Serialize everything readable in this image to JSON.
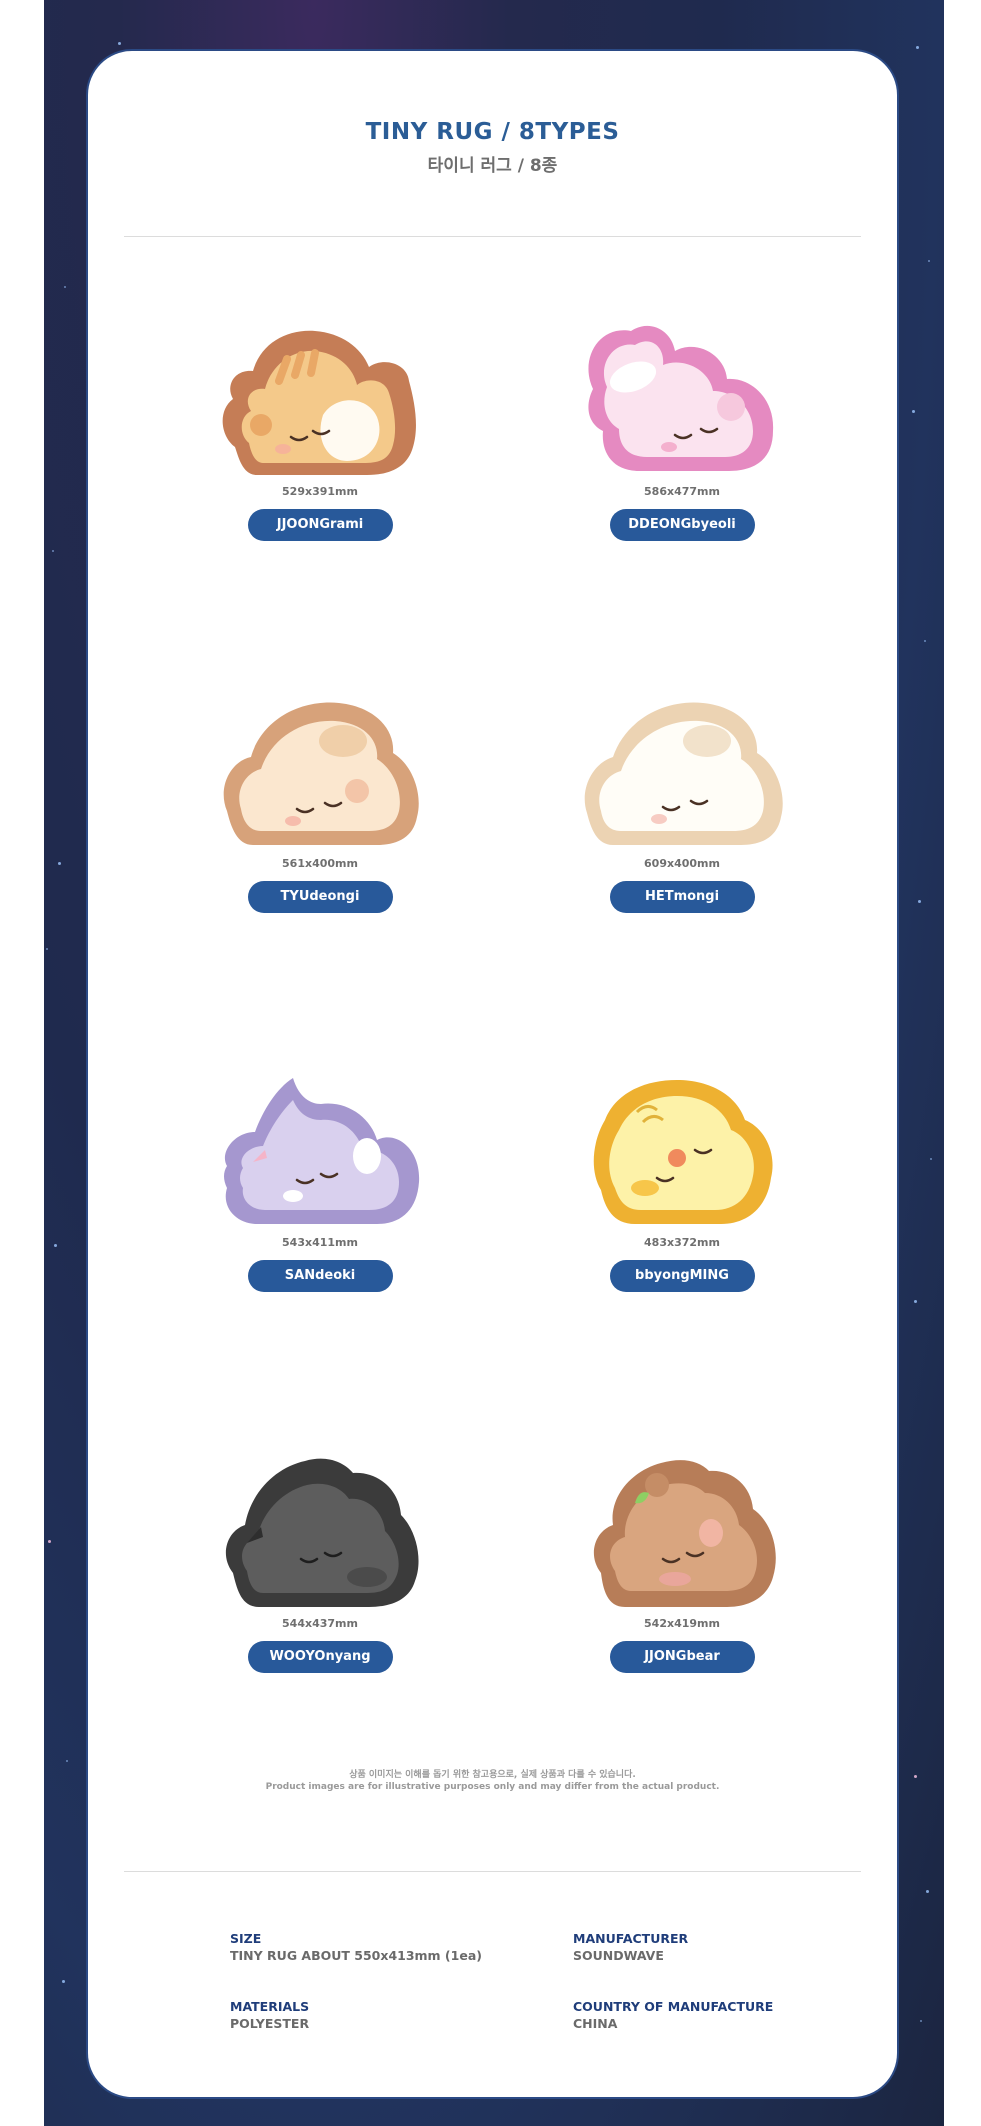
{
  "header": {
    "title": "TINY RUG / 8TYPES",
    "subtitle": "타이니 러그 / 8종"
  },
  "items": [
    {
      "name": "JJOONGrami",
      "size": "529x391mm",
      "icon": "tiger-rug-icon",
      "colors": {
        "outer": "#c57d56",
        "body": "#f4c98a",
        "accent": "#e9a866"
      }
    },
    {
      "name": "DDEONGbyeoli",
      "size": "586x477mm",
      "icon": "bunny-rug-icon",
      "colors": {
        "outer": "#e58ac1",
        "body": "#fbe3ef",
        "accent": "#f6c8dd"
      }
    },
    {
      "name": "TYUdeongi",
      "size": "561x400mm",
      "icon": "puppy-rug-icon",
      "colors": {
        "outer": "#d7a27a",
        "body": "#fbe7cf",
        "accent": "#f0cfa9"
      }
    },
    {
      "name": "HETmongi",
      "size": "609x400mm",
      "icon": "white-puppy-rug-icon",
      "colors": {
        "outer": "#ecd3b3",
        "body": "#fffdf7",
        "accent": "#f2e2cb"
      }
    },
    {
      "name": "SANdeoki",
      "size": "543x411mm",
      "icon": "cat-rug-icon",
      "colors": {
        "outer": "#a597cf",
        "body": "#d9d0ee",
        "accent": "#c5b8e4"
      }
    },
    {
      "name": "bbyongMING",
      "size": "483x372mm",
      "icon": "chick-rug-icon",
      "colors": {
        "outer": "#eeb131",
        "body": "#fdf2a8",
        "accent": "#f7df6b"
      }
    },
    {
      "name": "WOOYOnyang",
      "size": "544x437mm",
      "icon": "black-cat-rug-icon",
      "colors": {
        "outer": "#3b3b3b",
        "body": "#5d5d5d",
        "accent": "#4b4b4b"
      }
    },
    {
      "name": "JJONGbear",
      "size": "542x419mm",
      "icon": "bear-rug-icon",
      "colors": {
        "outer": "#b77d58",
        "body": "#d9a57f",
        "accent": "#c58d66"
      }
    }
  ],
  "notes": {
    "kr": "상품 이미지는 이해를 돕기 위한 참고용으로, 실제 상품과 다를 수 있습니다.",
    "en": "Product images are for illustrative purposes only and may differ from the actual product."
  },
  "specs": {
    "size_label": "SIZE",
    "size_value": "TINY RUG ABOUT 550x413mm (1ea)",
    "manufacturer_label": "MANUFACTURER",
    "manufacturer_value": "SOUNDWAVE",
    "materials_label": "MATERIALS",
    "materials_value": "POLYESTER",
    "country_label": "COUNTRY OF MANUFACTURE",
    "country_value": "CHINA"
  },
  "theme": {
    "title_color": "#2b5d96",
    "button_color": "#28599a",
    "spec_label_color": "#1f3d7a"
  }
}
